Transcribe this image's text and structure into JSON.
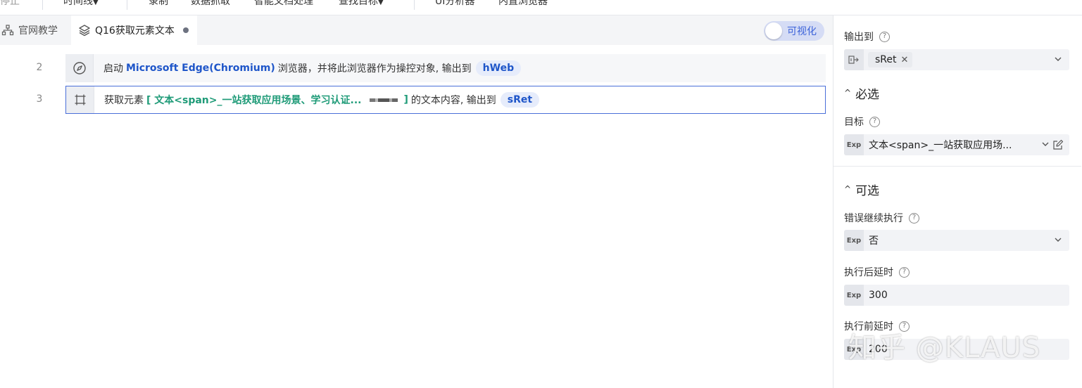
{
  "toolbar": {
    "stop": "停止",
    "timeline": "时间线",
    "record": "录制",
    "data_capture": "数据抓取",
    "doc_processing": "智能文档处理",
    "find_target": "查找目标",
    "ui_analyzer": "UI分析器",
    "builtin_browser": "内置浏览器"
  },
  "tabs": [
    {
      "label": "官网教学",
      "icon": "flowchart-icon"
    },
    {
      "label": "Q16获取元素文本",
      "icon": "layers-icon",
      "modified": true
    }
  ],
  "visualize_toggle": {
    "label": "可视化"
  },
  "steps": [
    {
      "line": "2",
      "icon": "compass-icon",
      "prefix": "启动",
      "browser": "Microsoft Edge(Chromium)",
      "middle": "浏览器，并将此浏览器作为操控对象, 输出到",
      "output": "hWeb"
    },
    {
      "line": "3",
      "icon": "element-frame-icon",
      "prefix": "获取元素",
      "target": "[ 文本<span>_一站获取应用场景、学习认证...",
      "target_end": "]",
      "middle": "的文本内容, 输出到",
      "output": "sRet"
    }
  ],
  "panel": {
    "output_label": "输出到",
    "output_value": "sRet",
    "required_section": "必选",
    "target_label": "目标",
    "target_value": "文本<span>_一站获取应用场...",
    "optional_section": "可选",
    "continue_on_error_label": "错误继续执行",
    "continue_on_error_value": "否",
    "delay_after_label": "执行后延时",
    "delay_after_value": "300",
    "delay_before_label": "执行前延时",
    "delay_before_value": "200",
    "exp_tag": "Exp"
  },
  "watermark": "知乎 @KLAUS"
}
